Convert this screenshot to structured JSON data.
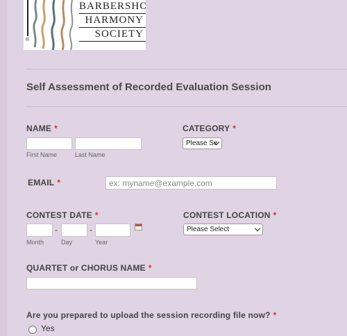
{
  "logo": {
    "lines": [
      "BARBERSHOP",
      "HARMONY",
      "SOCIETY"
    ],
    "registered_mark": "®"
  },
  "form": {
    "title": "Self Assessment of Recorded Evaluation Session",
    "required_mark": "*",
    "name": {
      "label": "NAME",
      "first_sublabel": "First Name",
      "last_sublabel": "Last Name",
      "first_value": "",
      "last_value": ""
    },
    "category": {
      "label": "CATEGORY",
      "selected": "Please Se"
    },
    "email": {
      "label": "EMAIL",
      "placeholder": "ex: myname@example.com"
    },
    "contest_date": {
      "label": "CONTEST DATE",
      "separator": "-",
      "month_sublabel": "Month",
      "day_sublabel": "Day",
      "year_sublabel": "Year"
    },
    "contest_location": {
      "label": "CONTEST LOCATION",
      "selected": "Please Select"
    },
    "quartet_chorus": {
      "label": "QUARTET or CHORUS NAME"
    },
    "upload_question": {
      "label": "Are you prepared to upload the session recording file now?",
      "option_yes": "Yes"
    }
  }
}
